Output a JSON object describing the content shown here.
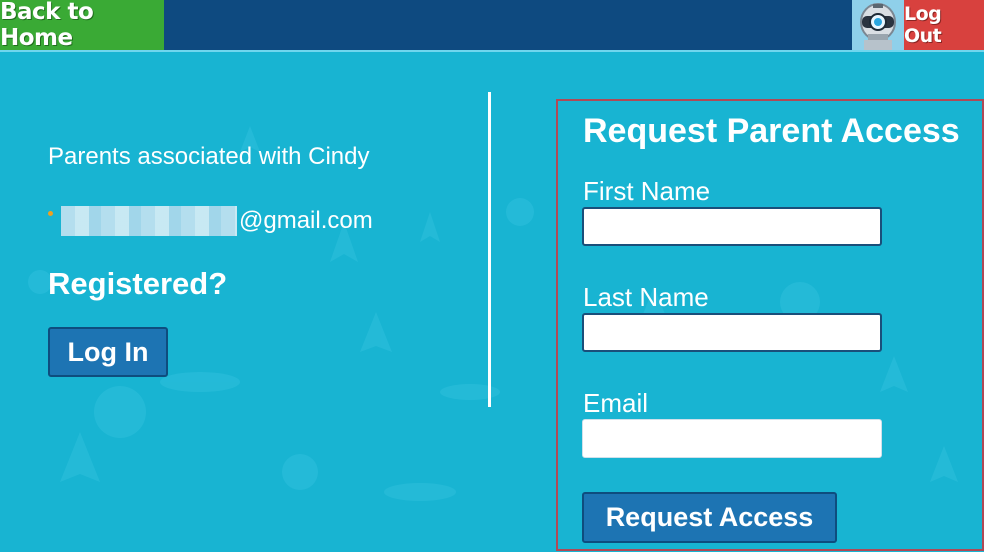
{
  "topbar": {
    "back_label": "Back to Home",
    "logout_label": "Log Out",
    "avatar_icon": "robot-avatar-icon"
  },
  "left": {
    "associated_text": "Parents associated with Cindy",
    "email_suffix": "@gmail.com",
    "registered_heading": "Registered?",
    "login_label": "Log In"
  },
  "form": {
    "title": "Request Parent Access",
    "first_name_label": "First Name",
    "first_name_value": "",
    "last_name_label": "Last Name",
    "last_name_value": "",
    "email_label": "Email",
    "email_value": "",
    "submit_label": "Request Access"
  },
  "colors": {
    "background": "#18b4d2",
    "topbar": "#0e4a80",
    "back_home": "#3aaa35",
    "logout": "#d8413e",
    "button": "#1d74b3"
  }
}
